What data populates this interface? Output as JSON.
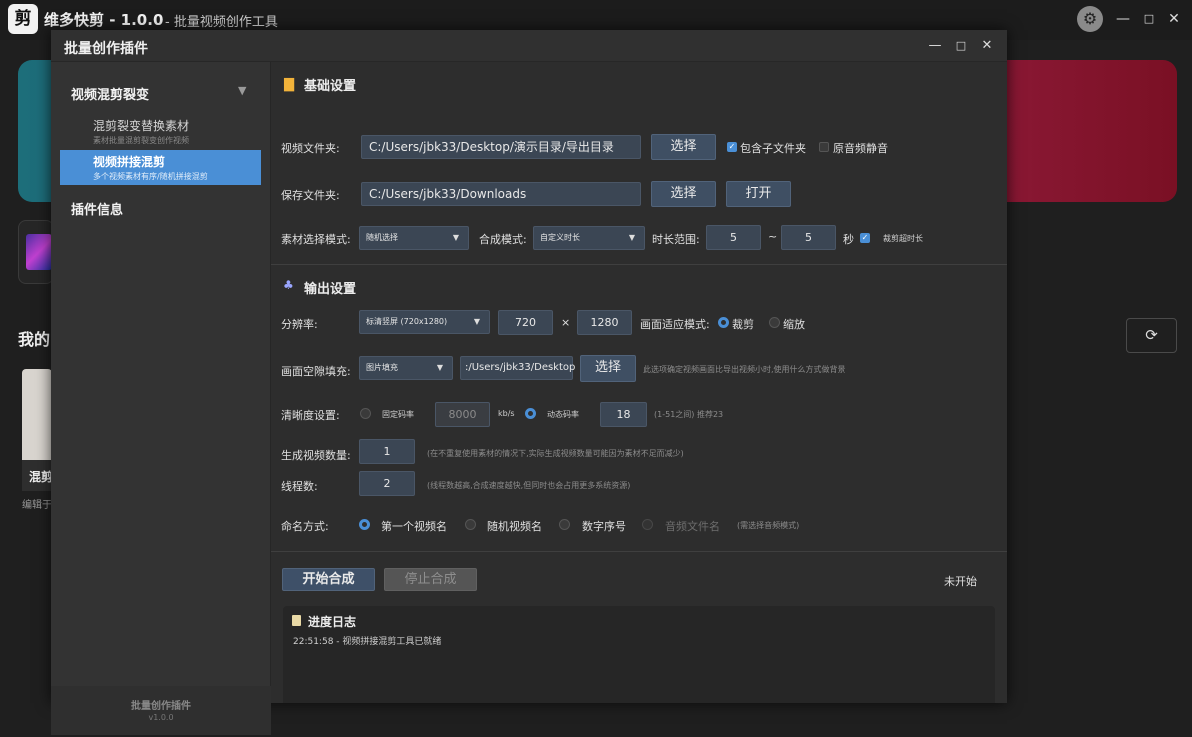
{
  "app": {
    "logo": "剪",
    "title": "维多快剪 - 1.0.0",
    "subtitle": "- 批量视频创作工具",
    "window_buttons": {
      "minimize": "—",
      "maximize": "□",
      "close": "✕"
    }
  },
  "background": {
    "my_heading": "我的",
    "card_title": "混剪",
    "card_sub": "编辑于",
    "refresh_icon": "⟳"
  },
  "dialog": {
    "title": "批量创作插件",
    "buttons": {
      "minimize": "—",
      "maximize": "□",
      "close": "✕"
    }
  },
  "sidebar": {
    "group_title": "视频混剪裂变",
    "group_arrow": "▼",
    "items": [
      {
        "label": "混剪裂变替换素材",
        "sub": "素材批量混剪裂变创作视频"
      },
      {
        "label": "视频拼接混剪",
        "sub": "多个视频素材有序/随机拼接混剪"
      }
    ],
    "plugin_info": "插件信息",
    "footer_title": "批量创作插件",
    "footer_version": "v1.0.0"
  },
  "basic": {
    "title": "基础设置",
    "video_folder_label": "视频文件夹:",
    "video_folder_value": "C:/Users/jbk33/Desktop/演示目录/导出目录",
    "select_label": "选择",
    "include_sub_label": "包含子文件夹",
    "include_sub_checked": true,
    "mute_label": "原音频静音",
    "mute_checked": false,
    "save_folder_label": "保存文件夹:",
    "save_folder_value": "C:/Users/jbk33/Downloads",
    "open_label": "打开",
    "material_mode_label": "素材选择模式:",
    "material_mode_value": "随机选择",
    "compose_mode_label": "合成模式:",
    "compose_mode_value": "自定义时长",
    "duration_label": "时长范围:",
    "duration_min": "5",
    "duration_sep": "~",
    "duration_max": "5",
    "duration_unit": "秒",
    "trim_label": "裁剪超时长",
    "trim_checked": true
  },
  "output": {
    "title": "输出设置",
    "resolution_label": "分辨率:",
    "resolution_value": "标清竖屏 (720x1280)",
    "width": "720",
    "times": "×",
    "height": "1280",
    "fit_label": "画面适应模式:",
    "fit_crop": "裁剪",
    "fit_scale": "缩放",
    "fill_label": "画面空隙填充:",
    "fill_value": "图片填充",
    "fill_path": ":/Users/jbk33/Desktop",
    "fill_select": "选择",
    "fill_hint": "此选项确定视频画面比导出视频小时,使用什么方式做背景",
    "quality_label": "清晰度设置:",
    "fixed_bitrate": "固定码率",
    "bitrate_value": "8000",
    "bitrate_unit": "kb/s",
    "dynamic_bitrate": "动态码率",
    "crf_value": "18",
    "crf_hint": "(1-51之间) 推荐23",
    "count_label": "生成视频数量:",
    "count_value": "1",
    "count_hint": "(在不重复使用素材的情况下,实际生成视频数量可能因为素材不足而减少)",
    "threads_label": "线程数:",
    "threads_value": "2",
    "threads_hint": "(线程数越高,合成速度越快,但同时也会占用更多系统资源)",
    "naming_label": "命名方式:",
    "naming_options": [
      "第一个视频名",
      "随机视频名",
      "数字序号",
      "音频文件名"
    ],
    "naming_hint": "(需选择音频模式)"
  },
  "actions": {
    "start": "开始合成",
    "stop": "停止合成",
    "status": "未开始"
  },
  "log": {
    "title": "进度日志",
    "lines": [
      "22:51:58 - 视频拼接混剪工具已就绪"
    ]
  },
  "colors": {
    "accent": "#4a8fd6",
    "dialog_bg": "#2d2d2d",
    "sidebar_bg": "#333333"
  },
  "icons": {
    "folder": "folder-icon",
    "output": "output-icon",
    "log": "log-icon",
    "gear": "gear-icon"
  }
}
